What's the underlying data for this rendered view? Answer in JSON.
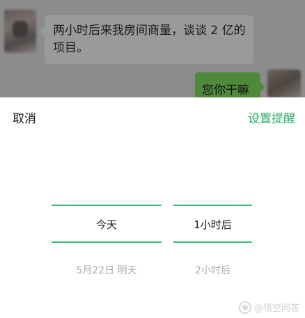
{
  "chat": {
    "incoming_message": "两小时后来我房间商量，谈谈 2 亿的项目。",
    "outgoing_message": "您你干嘛"
  },
  "sheet": {
    "cancel_label": "取消",
    "confirm_label": "设置提醒"
  },
  "picker": {
    "day_selected": "今天",
    "day_next": "5月22日 明天",
    "hour_selected": "1小时后",
    "hour_next": "2小时后"
  },
  "watermark": {
    "text": "@悟空问答"
  },
  "colors": {
    "accent": "#2aae67",
    "overlay": "#8c8c8c",
    "outgoing_bubble": "#4f8a3c"
  }
}
